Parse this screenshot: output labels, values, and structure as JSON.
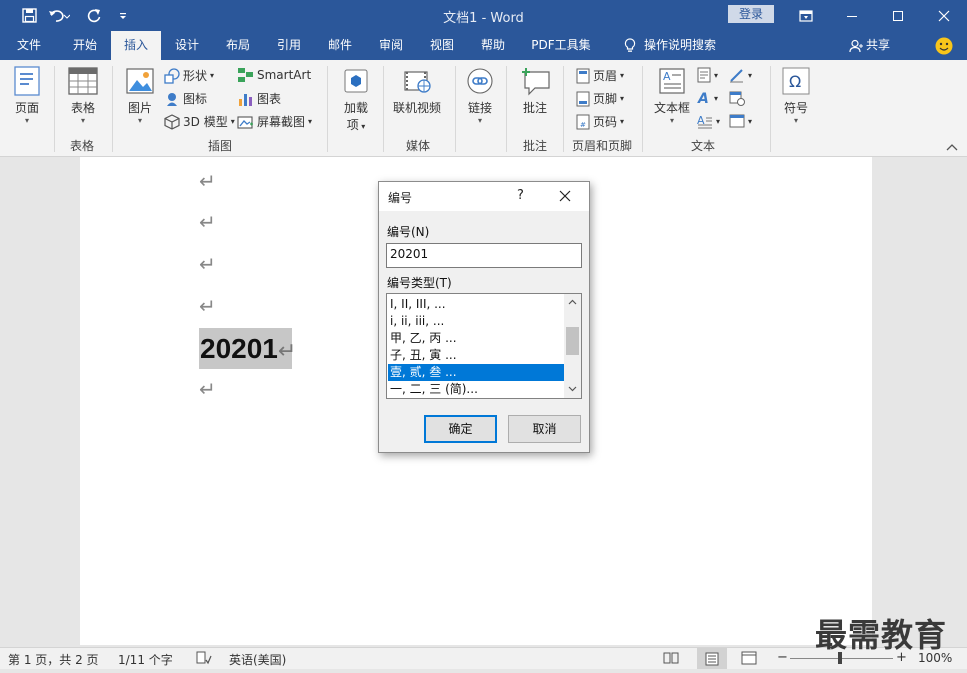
{
  "window": {
    "title": "文档1  -  Word",
    "login": "登录"
  },
  "tabs": [
    "文件",
    "开始",
    "插入",
    "设计",
    "布局",
    "引用",
    "邮件",
    "审阅",
    "视图",
    "帮助",
    "PDF工具集"
  ],
  "active_tab": "插入",
  "search_hint": "操作说明搜索",
  "share": "共享",
  "ribbon": {
    "page": "页面",
    "table": "表格",
    "picture": "图片",
    "shapes": "形状",
    "icons": "图标",
    "model3d": "3D 模型",
    "smartart": "SmartArt",
    "chart": "图表",
    "screenshot": "屏幕截图",
    "addins_l1": "加载",
    "addins_l2": "项",
    "online_video": "联机视频",
    "link": "链接",
    "comment": "批注",
    "header": "页眉",
    "footer": "页脚",
    "page_number": "页码",
    "textbox": "文本框",
    "symbol": "符号",
    "groups": {
      "table": "表格",
      "illustrations": "插图",
      "media": "媒体",
      "comments": "批注",
      "header_footer": "页眉和页脚",
      "text": "文本"
    }
  },
  "document": {
    "big_number": "20201"
  },
  "dialog": {
    "title": "编号",
    "help": "?",
    "number_label": "编号(N)",
    "number_value": "20201",
    "type_label": "编号类型(T)",
    "types": [
      "I, II, III, ...",
      "i, ii, iii, ...",
      "甲, 乙, 丙 ...",
      "子, 丑, 寅 ...",
      "壹, 贰, 叁 ...",
      "一, 二, 三 (简)..."
    ],
    "selected_index": 4,
    "ok": "确定",
    "cancel": "取消"
  },
  "status": {
    "page": "第 1 页，共 2 页",
    "words": "1/11 个字",
    "language": "英语(美国)",
    "zoom": "100%"
  },
  "watermark": "最需教育",
  "colors": {
    "brand": "#2b579a",
    "selection": "#0078d7"
  }
}
